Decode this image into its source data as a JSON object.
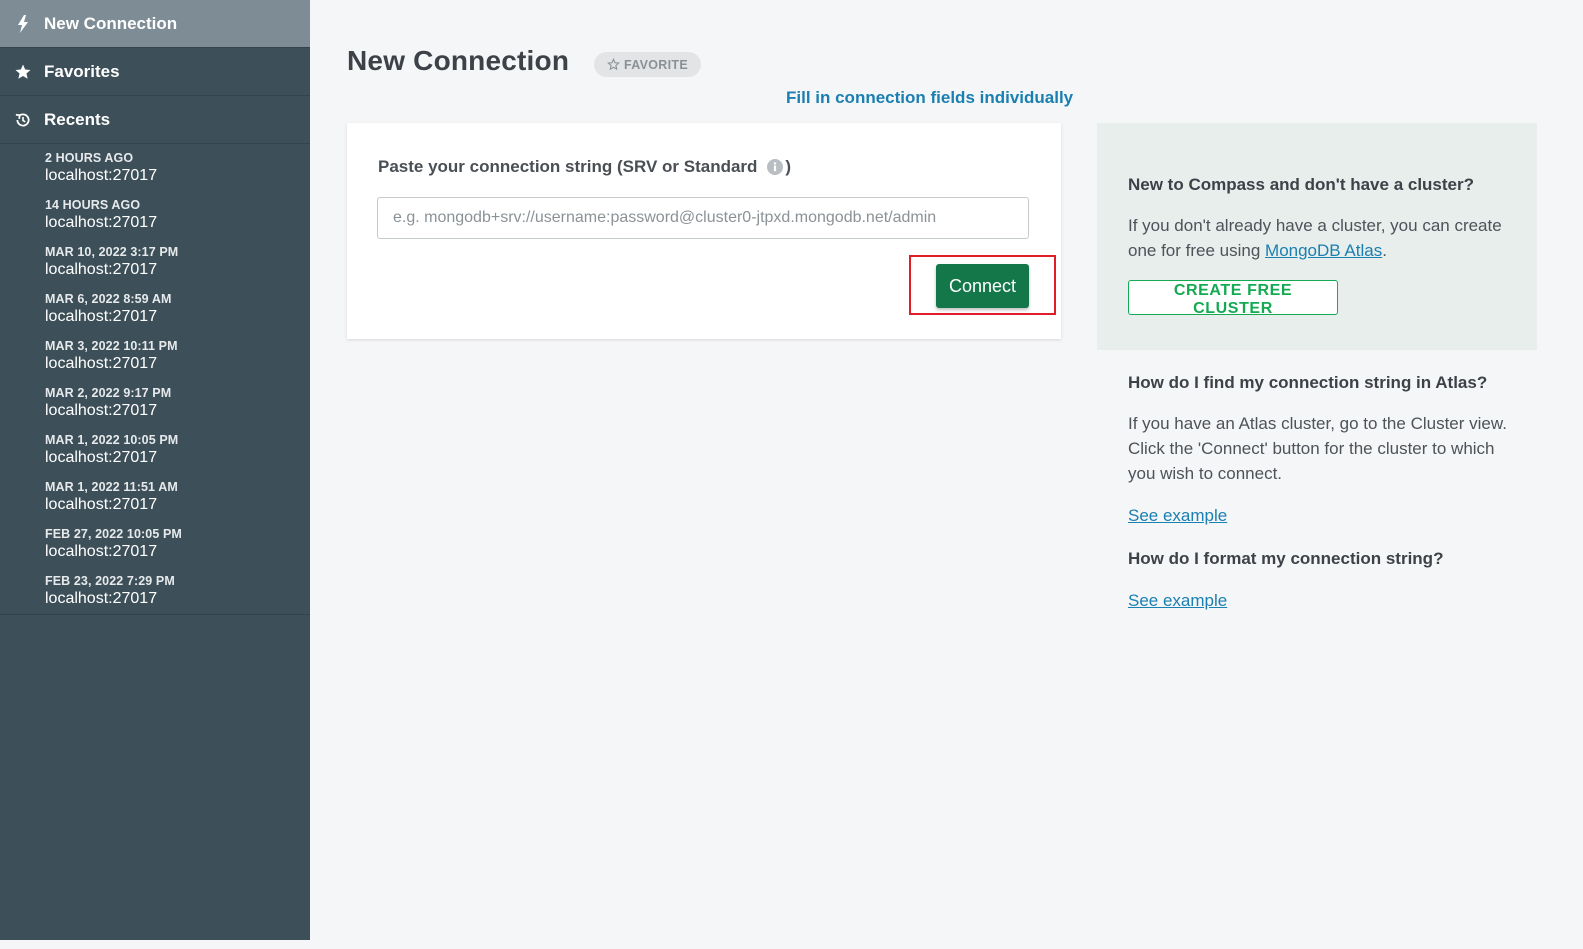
{
  "sidebar": {
    "new_connection": "New Connection",
    "favorites": "Favorites",
    "recents": "Recents",
    "recent_items": [
      {
        "time": "2 HOURS AGO",
        "host": "localhost:27017"
      },
      {
        "time": "14 HOURS AGO",
        "host": "localhost:27017"
      },
      {
        "time": "MAR 10, 2022 3:17 PM",
        "host": "localhost:27017"
      },
      {
        "time": "MAR 6, 2022 8:59 AM",
        "host": "localhost:27017"
      },
      {
        "time": "MAR 3, 2022 10:11 PM",
        "host": "localhost:27017"
      },
      {
        "time": "MAR 2, 2022 9:17 PM",
        "host": "localhost:27017"
      },
      {
        "time": "MAR 1, 2022 10:05 PM",
        "host": "localhost:27017"
      },
      {
        "time": "MAR 1, 2022 11:51 AM",
        "host": "localhost:27017"
      },
      {
        "time": "FEB 27, 2022 10:05 PM",
        "host": "localhost:27017"
      },
      {
        "time": "FEB 23, 2022 7:29 PM",
        "host": "localhost:27017"
      }
    ]
  },
  "main": {
    "title": "New Connection",
    "favorite_label": "FAVORITE",
    "fill_link": "Fill in connection fields individually",
    "conn_label": "Paste your connection string (SRV or Standard",
    "conn_label_close": ")",
    "input_value": "",
    "input_placeholder": "e.g. mongodb+srv://username:password@cluster0-jtpxd.mongodb.net/admin",
    "connect_label": "Connect"
  },
  "help": {
    "heading1": "New to Compass and don't have a cluster?",
    "text1_before": "If you don't already have a cluster, you can create one for free using ",
    "atlas_link": "MongoDB Atlas",
    "text1_after": ".",
    "create_cluster": "CREATE FREE CLUSTER",
    "heading2": "How do I find my connection string in Atlas?",
    "text2": "If you have an Atlas cluster, go to the Cluster view. Click the 'Connect' button for the cluster to which you wish to connect.",
    "see_example1": "See example",
    "heading3": "How do I format my connection string?",
    "see_example2": "See example"
  },
  "colors": {
    "sidebar_bg": "#3d4f58",
    "sidebar_active": "#7e8d95",
    "connect_green": "#13774a",
    "cluster_green": "#13aa52",
    "link_blue": "#1a7fb1",
    "highlight_red": "#e11d2a"
  },
  "icons": {
    "new_connection": "lightning-bolt-icon",
    "favorites": "star-icon",
    "recents": "history-icon",
    "favorite_button": "star-outline-icon",
    "info": "info-icon"
  }
}
